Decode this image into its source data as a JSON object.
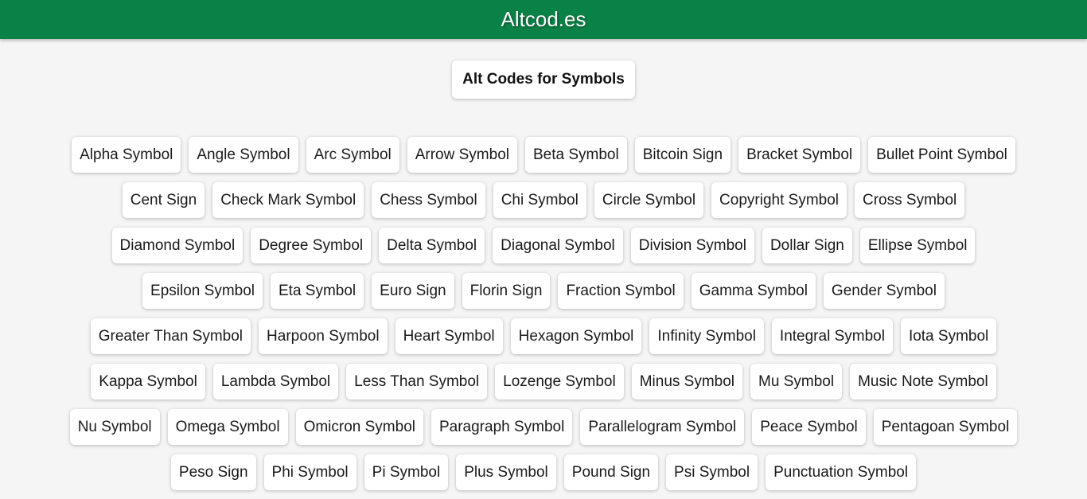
{
  "header": {
    "title": "Altcod.es",
    "brand_color": "#0a8147"
  },
  "main": {
    "heading": "Alt Codes for Symbols",
    "symbols": [
      "Alpha Symbol",
      "Angle Symbol",
      "Arc Symbol",
      "Arrow Symbol",
      "Beta Symbol",
      "Bitcoin Sign",
      "Bracket Symbol",
      "Bullet Point Symbol",
      "Cent Sign",
      "Check Mark Symbol",
      "Chess Symbol",
      "Chi Symbol",
      "Circle Symbol",
      "Copyright Symbol",
      "Cross Symbol",
      "Diamond Symbol",
      "Degree Symbol",
      "Delta Symbol",
      "Diagonal Symbol",
      "Division Symbol",
      "Dollar Sign",
      "Ellipse Symbol",
      "Epsilon Symbol",
      "Eta Symbol",
      "Euro Sign",
      "Florin Sign",
      "Fraction Symbol",
      "Gamma Symbol",
      "Gender Symbol",
      "Greater Than Symbol",
      "Harpoon Symbol",
      "Heart Symbol",
      "Hexagon Symbol",
      "Infinity Symbol",
      "Integral Symbol",
      "Iota Symbol",
      "Kappa Symbol",
      "Lambda Symbol",
      "Less Than Symbol",
      "Lozenge Symbol",
      "Minus Symbol",
      "Mu Symbol",
      "Music Note Symbol",
      "Nu Symbol",
      "Omega Symbol",
      "Omicron Symbol",
      "Paragraph Symbol",
      "Parallelogram Symbol",
      "Peace Symbol",
      "Pentagoan Symbol",
      "Peso Sign",
      "Phi Symbol",
      "Pi Symbol",
      "Plus Symbol",
      "Pound Sign",
      "Psi Symbol",
      "Punctuation Symbol"
    ]
  }
}
